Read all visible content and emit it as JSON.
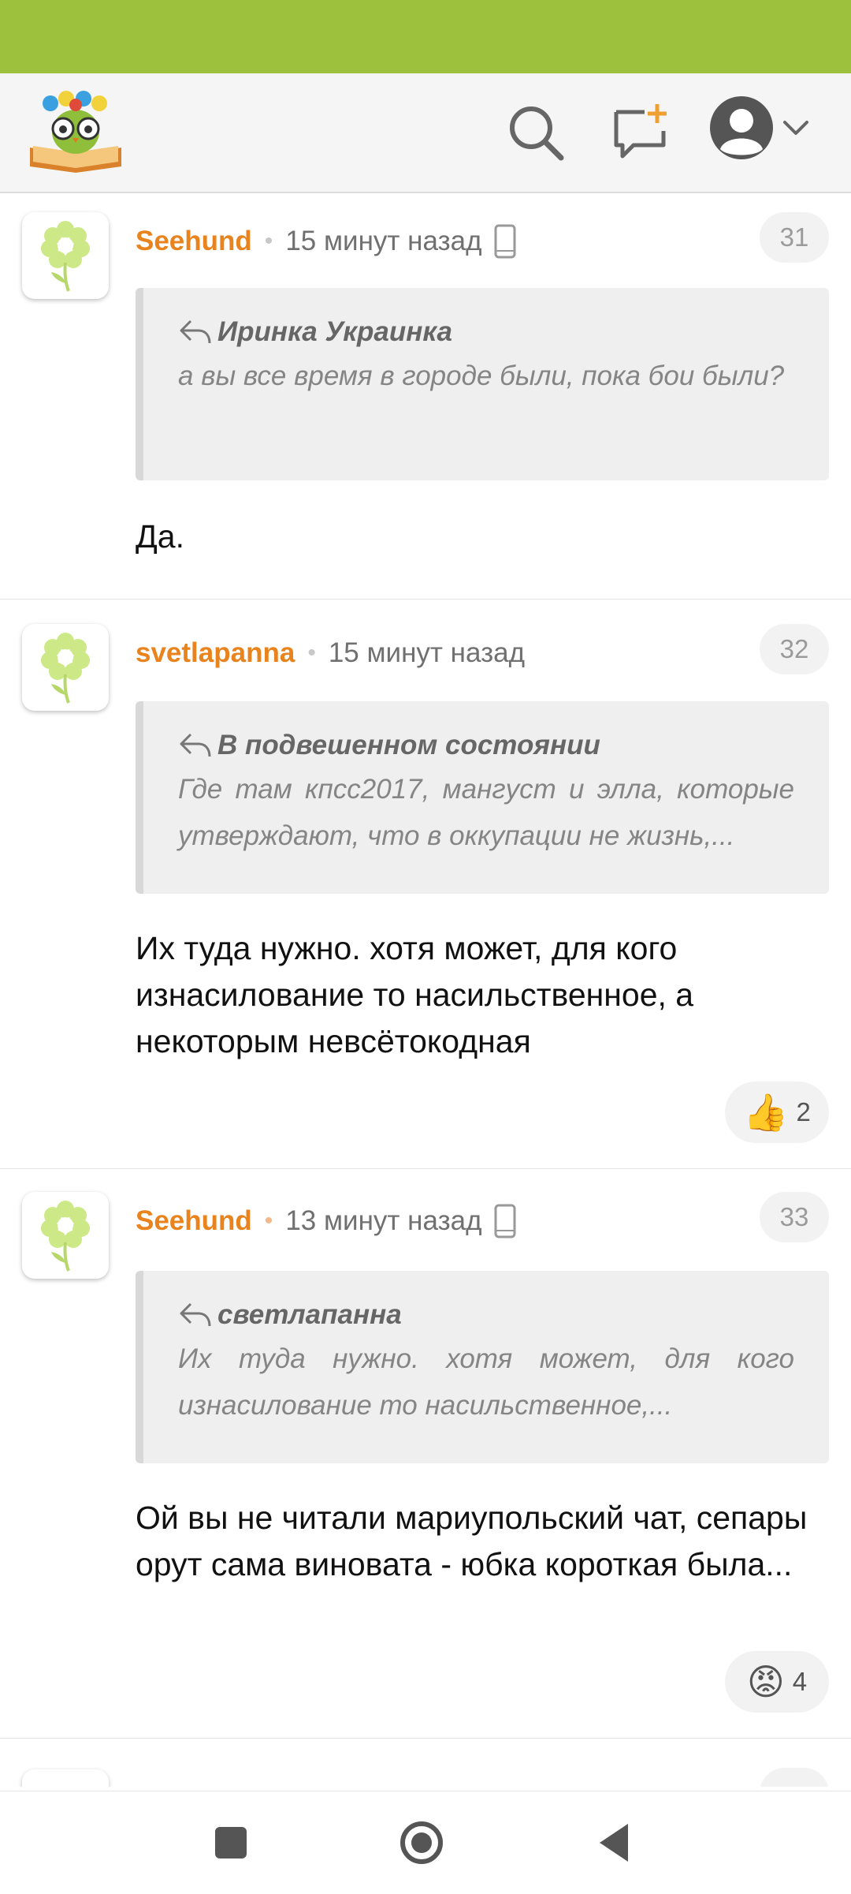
{
  "comments": [
    {
      "author": "Seehund",
      "time": "15 минут назад",
      "number": "31",
      "quote_author": "Иринка Украинка",
      "quote_text": "а вы все время в городе были, пока бои были?",
      "text": "Да.",
      "reaction": null
    },
    {
      "author": "svetlapanna",
      "time": "15 минут назад",
      "number": "32",
      "quote_author": "В подвешенном состоянии",
      "quote_text": "Где там кпсс2017, мангуст и элла, которые утверждают, что в оккупации не жизнь,...",
      "text": "Их туда нужно. хотя может, для кого изнасилование то насильственное, а некоторым невсётокодная",
      "reaction": {
        "emoji": "👍",
        "count": "2"
      }
    },
    {
      "author": "Seehund",
      "time": "13 минут назад",
      "number": "33",
      "quote_author": "светлапанна",
      "quote_text": "Их туда нужно. хотя может, для кого изнасилование то насильственное,...",
      "text": "Ой вы не читали мариупольский чат, сепары орут сама виновата - юбка короткая была...",
      "reaction": {
        "emoji": "😡",
        "count": "4"
      }
    }
  ],
  "colors": {
    "topbar": "#9dc13c",
    "author": "#e8831d",
    "accent_new": "#f0a030"
  },
  "icons": {
    "logo": "owl-book-logo",
    "search": "search-icon",
    "new_post": "new-message-icon",
    "profile": "user-avatar-icon",
    "device": "mobile-device-icon",
    "reply": "reply-arrow-icon"
  }
}
